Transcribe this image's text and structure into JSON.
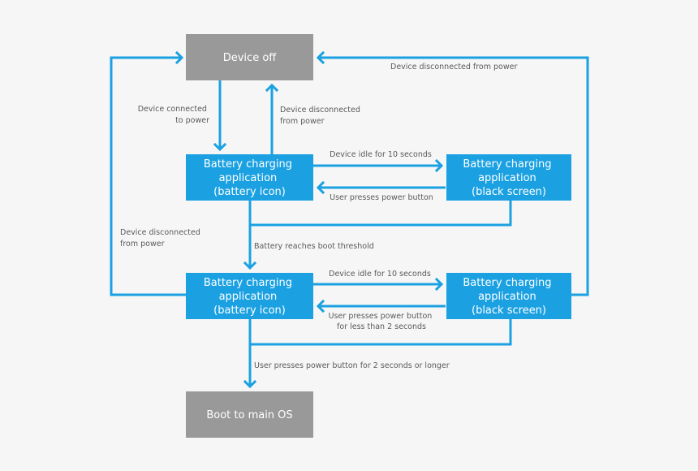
{
  "diagram": {
    "colors": {
      "background": "#f6f6f6",
      "state_gray": "#999999",
      "state_blue": "#1ba1e2",
      "arrow": "#1ba1e2",
      "label_text": "#5a5a5a",
      "node_text": "#ffffff"
    },
    "nodes": {
      "device_off": {
        "label": "Device off"
      },
      "charging_icon_1": {
        "lines": [
          "Battery charging",
          "application",
          "(battery icon)"
        ]
      },
      "charging_black_1": {
        "lines": [
          "Battery charging",
          "application",
          "(black screen)"
        ]
      },
      "charging_icon_2": {
        "lines": [
          "Battery charging",
          "application",
          "(battery icon)"
        ]
      },
      "charging_black_2": {
        "lines": [
          "Battery charging",
          "application",
          "(black screen)"
        ]
      },
      "boot_main_os": {
        "label": "Boot to main OS"
      }
    },
    "edges": {
      "connected_to_power": [
        "Device connected",
        "to power"
      ],
      "disconnected_up": [
        "Device disconnected",
        "from power"
      ],
      "disconnected_right": "Device disconnected from power",
      "disconnected_left": [
        "Device disconnected",
        "from power"
      ],
      "idle_1": "Device idle for 10 seconds",
      "power_button_1": "User presses power button",
      "boot_threshold": "Battery reaches boot threshold",
      "idle_2": "Device idle for 10 seconds",
      "power_button_short": [
        "User presses power button",
        "for less than 2 seconds"
      ],
      "power_button_long": "User presses power button for 2 seconds or longer"
    }
  }
}
